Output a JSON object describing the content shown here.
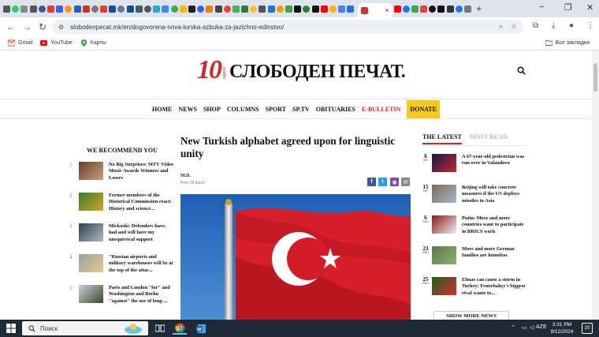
{
  "browser": {
    "url": "slobodenpecat.mk/en/dogovorena-nova-turska-azbuka-za-jazichno-edinstvo/",
    "active_tab_close": "×",
    "new_tab": "+",
    "window_minimize": "−",
    "window_maximize": "❐",
    "window_close": "✕",
    "bookmarks": [
      {
        "label": "Gmail"
      },
      {
        "label": "YouTube"
      },
      {
        "label": "Карты"
      }
    ],
    "all_bookmarks": "Все закладки"
  },
  "site": {
    "logo_number": "10",
    "logo_sub": "години",
    "logo_text": "СЛОБОДЕН ПЕЧАТ."
  },
  "nav": [
    "HOME",
    "NEWS",
    "SHOP",
    "COLUMNS",
    "SPORT",
    "SP.TV",
    "OBITUARIES",
    "E-BULLETIN",
    "DONATE"
  ],
  "recommend": {
    "title": "WE RECOMMEND YOU",
    "items": [
      {
        "num": "1",
        "text": "No Big Surprises: MTV Video Music Awards Winners and Losers"
      },
      {
        "num": "2",
        "text": "Former members of the Historical Commission react: History and science..."
      },
      {
        "num": "3",
        "text": "Mickoski: Defenders have, had and will have my unequivocal support"
      },
      {
        "num": "4",
        "text": "\"Russian airports and military warehouses will be at the top of the attac..."
      },
      {
        "num": "5",
        "text": "Paris and London \"for\" and Washington and Berlin \"against\" the use of long-..."
      }
    ]
  },
  "article": {
    "title": "New Turkish alphabet agreed upon for linguistic unity",
    "author": "M.D.",
    "time": "Prev 19 hours"
  },
  "latest": {
    "tab_latest": "THE LATEST",
    "tab_most": "MOST READ",
    "items": [
      {
        "num": "6",
        "unit": "sec",
        "text": "A 67-year-old pedestrian was run over in Valandovo"
      },
      {
        "num": "15",
        "unit": "sec",
        "text": "Beijing will take concrete measures if the US deploys missiles in Asia"
      },
      {
        "num": "6",
        "unit": "min",
        "text": "Putin: More and more countries want to participate in BRICS work"
      },
      {
        "num": "23",
        "unit": "min",
        "text": "More and more German families are homeless"
      },
      {
        "num": "25",
        "unit": "min",
        "text": "Elmas can cause a storm in Turkey: Fenerbahçe's biggest rival wants to..."
      }
    ],
    "show_more": "SHOW MORE NEWS"
  },
  "taskbar": {
    "search": "Поиск",
    "lang": "AZE",
    "time": "3:31 PM",
    "date": "9/12/2024",
    "notif": "20"
  }
}
